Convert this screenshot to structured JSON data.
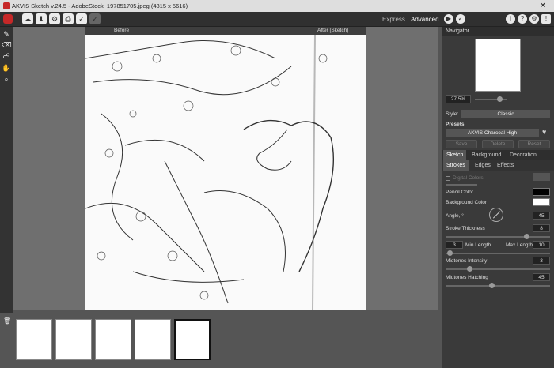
{
  "window": {
    "title": "AKVIS Sketch v.24.5 - AdobeStock_197851705.jpeg (4815 x 5616)",
    "close_glyph": "✕"
  },
  "toolbar": {
    "mode_express": "Express",
    "mode_advanced": "Advanced"
  },
  "canvas": {
    "before_label": "Before",
    "after_label": "After [Sketch]"
  },
  "navigator": {
    "title": "Navigator",
    "zoom": "27.5%"
  },
  "settings": {
    "style_label": "Style:",
    "style_value": "Classic",
    "presets_label": "Presets",
    "preset_value": "AKVIS Charcoal High",
    "buttons": {
      "save": "Save",
      "delete": "Delete",
      "reset": "Reset"
    }
  },
  "tabs": {
    "main": [
      "Sketch",
      "Background",
      "Decoration"
    ],
    "sub": [
      "Strokes",
      "Edges",
      "Effects"
    ]
  },
  "strokes": {
    "digital_colors": "Digital Colors",
    "pencil_color_label": "Pencil Color",
    "pencil_color": "#000000",
    "background_color_label": "Background Color",
    "background_color": "#ffffff",
    "angle_label": "Angle, °",
    "angle": "45",
    "thickness_label": "Stroke Thickness",
    "thickness": "8",
    "min_length": "3",
    "min_length_label": "Min Length",
    "max_length_label": "Max Length",
    "max_length": "10",
    "midtones_intensity_label": "Midtones Intensity",
    "midtones_intensity": "3",
    "midtones_hatching_label": "Midtones Hatching",
    "midtones_hatching": "45"
  },
  "filmstrip": {
    "count": 5,
    "selected_index": 4
  }
}
